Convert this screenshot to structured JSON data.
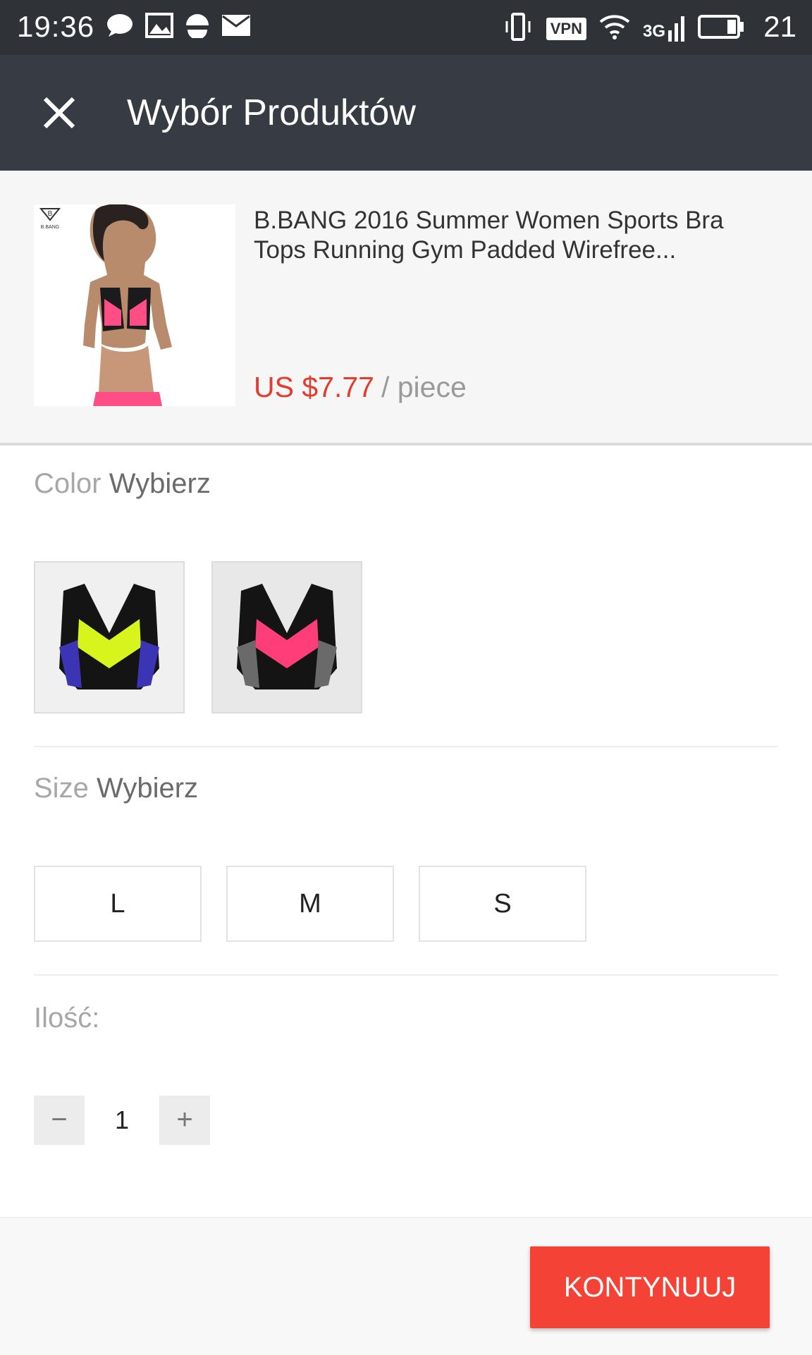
{
  "status_bar": {
    "time": "19:36",
    "vpn_label": "VPN",
    "network_label": "3G",
    "battery_percent": "21",
    "icons": [
      "chat-icon",
      "image-icon",
      "data-saver-icon",
      "mail-icon",
      "vibrate-icon",
      "vpn-icon",
      "wifi-icon",
      "signal-icon",
      "battery-icon"
    ]
  },
  "app_bar": {
    "title": "Wybór Produktów",
    "close_icon": "close-icon"
  },
  "product": {
    "brand_logo": "B.BANG",
    "title": "B.BANG 2016 Summer Women Sports Bra Tops Running Gym Padded Wirefree...",
    "price": "US $7.77",
    "unit": "/ piece"
  },
  "color_section": {
    "label": "Color",
    "action": "Wybierz",
    "options": [
      {
        "name": "yellow-blue"
      },
      {
        "name": "pink-gray"
      }
    ]
  },
  "size_section": {
    "label": "Size",
    "action": "Wybierz",
    "options": [
      "L",
      "M",
      "S"
    ]
  },
  "quantity_section": {
    "label": "Ilość:",
    "minus": "−",
    "value": "1",
    "plus": "+"
  },
  "bottom": {
    "continue_label": "KONTYNUUJ"
  },
  "colors": {
    "status_bar_bg": "#2f3338",
    "app_bar_bg": "#373c44",
    "price_red": "#e53b2c",
    "button_red": "#f44336"
  }
}
